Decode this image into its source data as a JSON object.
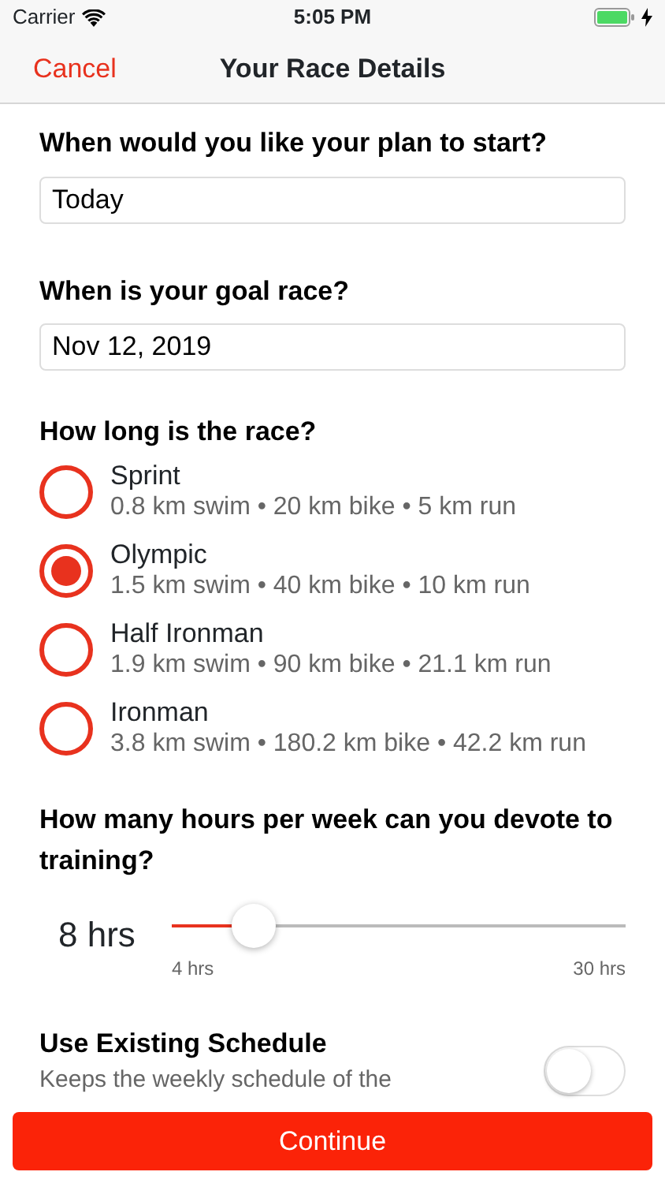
{
  "status_bar": {
    "carrier": "Carrier",
    "time": "5:05 PM",
    "charging": true
  },
  "nav": {
    "cancel": "Cancel",
    "title": "Your Race Details"
  },
  "start": {
    "question": "When would you like your plan to start?",
    "value": "Today"
  },
  "goal": {
    "question": "When is your goal race?",
    "value": "Nov 12, 2019"
  },
  "race": {
    "question": "How long is the race?",
    "options": [
      {
        "name": "Sprint",
        "detail": "0.8 km swim • 20 km bike • 5 km run",
        "selected": false
      },
      {
        "name": "Olympic",
        "detail": "1.5 km swim • 40 km bike • 10 km run",
        "selected": true
      },
      {
        "name": "Half Ironman",
        "detail": "1.9 km swim • 90 km bike • 21.1 km run",
        "selected": false
      },
      {
        "name": "Ironman",
        "detail": "3.8 km swim • 180.2 km bike • 42.2 km run",
        "selected": false
      }
    ]
  },
  "hours": {
    "question": "How many hours per week can you devote to training?",
    "reading": "8 hrs",
    "level": 0.18,
    "min_label": "4 hrs",
    "max_label": "30 hrs"
  },
  "schedule": {
    "title": "Use Existing Schedule",
    "detail": "Keeps the weekly schedule of the",
    "on": false
  },
  "continue_button": "Continue"
}
